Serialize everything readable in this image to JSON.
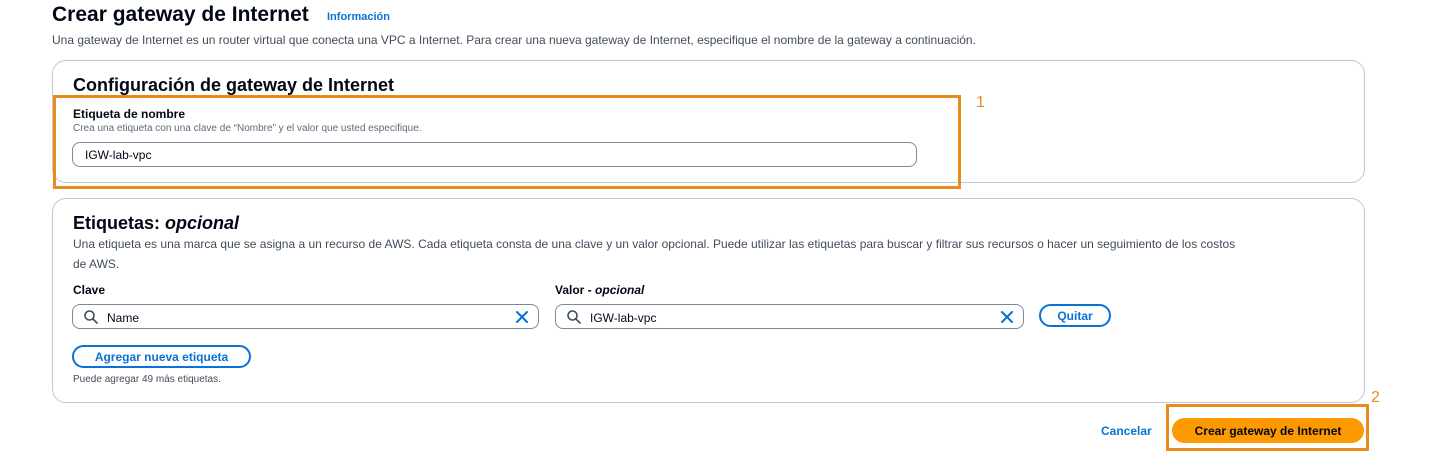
{
  "header": {
    "title": "Crear gateway de Internet",
    "info_link": "Información",
    "description": "Una gateway de Internet es un router virtual que conecta una VPC a Internet. Para crear una nueva gateway de Internet, especifique el nombre de la gateway a continuación."
  },
  "config_panel": {
    "title": "Configuración de gateway de Internet",
    "name_label": "Etiqueta de nombre",
    "name_hint": "Crea una etiqueta con una clave de “Nombre” y el valor que usted especifique.",
    "name_value": "IGW-lab-vpc"
  },
  "tags_panel": {
    "title_main": "Etiquetas:",
    "title_optional": "opcional",
    "description_line1": "Una etiqueta es una marca que se asigna a un recurso de AWS. Cada etiqueta consta de una clave y un valor opcional. Puede utilizar las etiquetas para buscar y filtrar sus recursos o hacer un seguimiento de los costos",
    "description_line2": "de AWS.",
    "key_label": "Clave",
    "value_label_main": "Valor -",
    "value_label_optional": "opcional",
    "key_value": "Name",
    "value_value": "IGW-lab-vpc",
    "remove_button": "Quitar",
    "add_button": "Agregar nueva etiqueta",
    "remaining_note": "Puede agregar 49 más etiquetas."
  },
  "footer": {
    "cancel_label": "Cancelar",
    "submit_label": "Crear gateway de Internet"
  },
  "annotations": {
    "step1": "1",
    "step2": "2",
    "highlight_color": "#ea8b1e"
  },
  "colors": {
    "link": "#0972d3",
    "primary": "#ff9900",
    "text": "#000716"
  },
  "icons": [
    "search-icon",
    "close-icon"
  ]
}
